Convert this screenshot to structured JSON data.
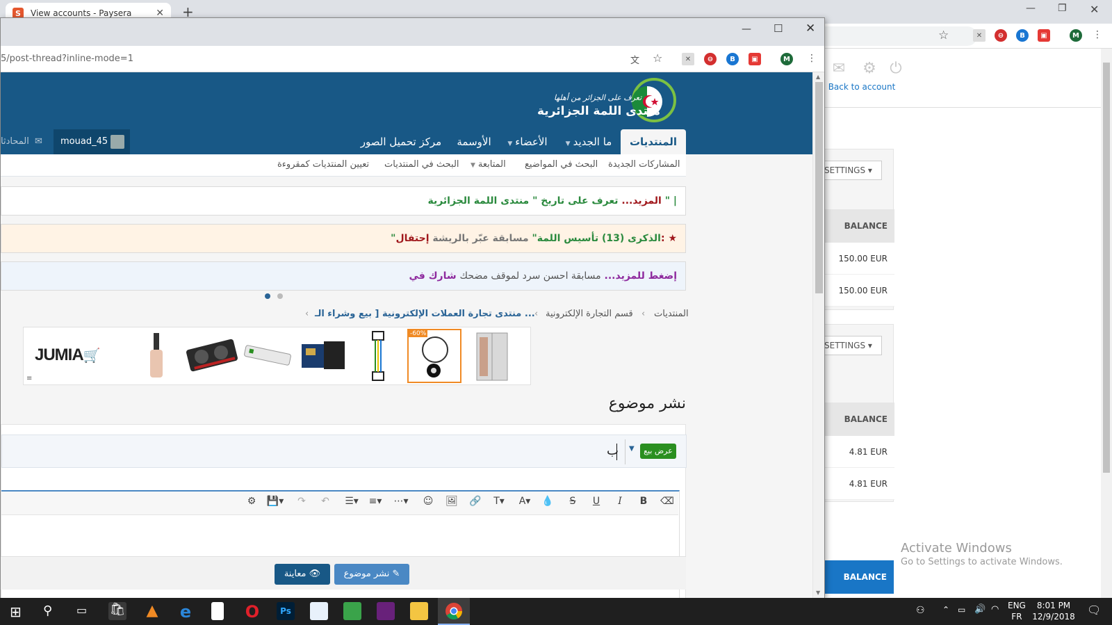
{
  "bg_browser": {
    "tab_title": "View accounts - Paysera",
    "back_to_account": "Back to account",
    "settings_label": "SETTINGS",
    "balance_header": "BALANCE",
    "balances_group1": [
      "150.00 EUR",
      "150.00 EUR"
    ],
    "balances_group2": [
      "4.81 EUR",
      "4.81 EUR"
    ],
    "bottom_header": "BALANCE",
    "profile_initial": "M"
  },
  "activate": {
    "title": "Activate Windows",
    "subtitle": "Go to Settings to activate Windows."
  },
  "browser": {
    "url": "5/post-thread?inline-mode=1",
    "profile_initial": "M"
  },
  "forum": {
    "logo_tagline": "تعرف على الجزائر من أهلها",
    "logo_name": "منتدى اللمة الجزائرية",
    "nav": {
      "forums": "المنتديات",
      "whats_new": "ما الجديد",
      "members": "الأعضاء",
      "badges": "الأوسمة",
      "image_upload": "مركز تحميل الصور"
    },
    "username": "mouad_45",
    "conversations": "المحادثا",
    "subnav": {
      "new_posts": "المشاركات الجديدة",
      "search_threads": "البحث في المواضيع",
      "watched": "المتابعة",
      "search_forums": "البحث في المنتديات",
      "mark_read": "تعيين المنتديات كمقروءة"
    },
    "notice1": {
      "text": "تعرف على تاريخ \" منتدى اللمة الجزائرية \" |",
      "more": "المزيد..."
    },
    "notice2": {
      "label": "إحتفال:",
      "text": "مسابقة عبّر بالريشة",
      "quote": "\"الذكرى (13) تأسيس اللمة\""
    },
    "notice3": {
      "label": "شارك في",
      "text": "مسابقة احسن سرد لموقف مضحك",
      "more": "إضغط للمزيد..."
    },
    "breadcrumb": [
      "المنتديات",
      "قسم التجارة الإلكترونية",
      "منتدى تجارة العملات الإلكترونية [ بيع وشراء الـ ..."
    ],
    "ad_badge": "-60%",
    "ad_brand": "JUMIA",
    "page_title": "نشر موضوع",
    "prefix": "عرض بيع",
    "thread_title_value": "ب",
    "preview_button": "معاينة",
    "post_button": "نشر موضوع"
  },
  "taskbar": {
    "lang_top": "ENG",
    "lang_bottom": "FR",
    "time": "8:01 PM",
    "date": "12/9/2018"
  }
}
